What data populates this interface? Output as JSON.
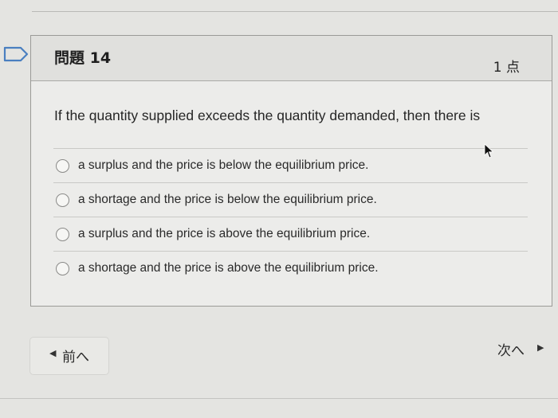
{
  "question": {
    "number_label": "問題 14",
    "points_label": "1 点",
    "text": "If the quantity supplied exceeds the quantity demanded, then there is",
    "options": [
      {
        "label": "a surplus and the price is below the equilibrium price."
      },
      {
        "label": "a shortage and the price is below the equilibrium price."
      },
      {
        "label": "a surplus and the price is above the equilibrium price."
      },
      {
        "label": "a shortage and the price is above the equilibrium price."
      }
    ]
  },
  "navigation": {
    "prev_label": "前へ",
    "next_label": "次へ",
    "prev_arrow": "◀",
    "next_arrow": "▶"
  },
  "icons": {
    "flag": "flag-icon",
    "cursor": "mouse-pointer-icon"
  }
}
